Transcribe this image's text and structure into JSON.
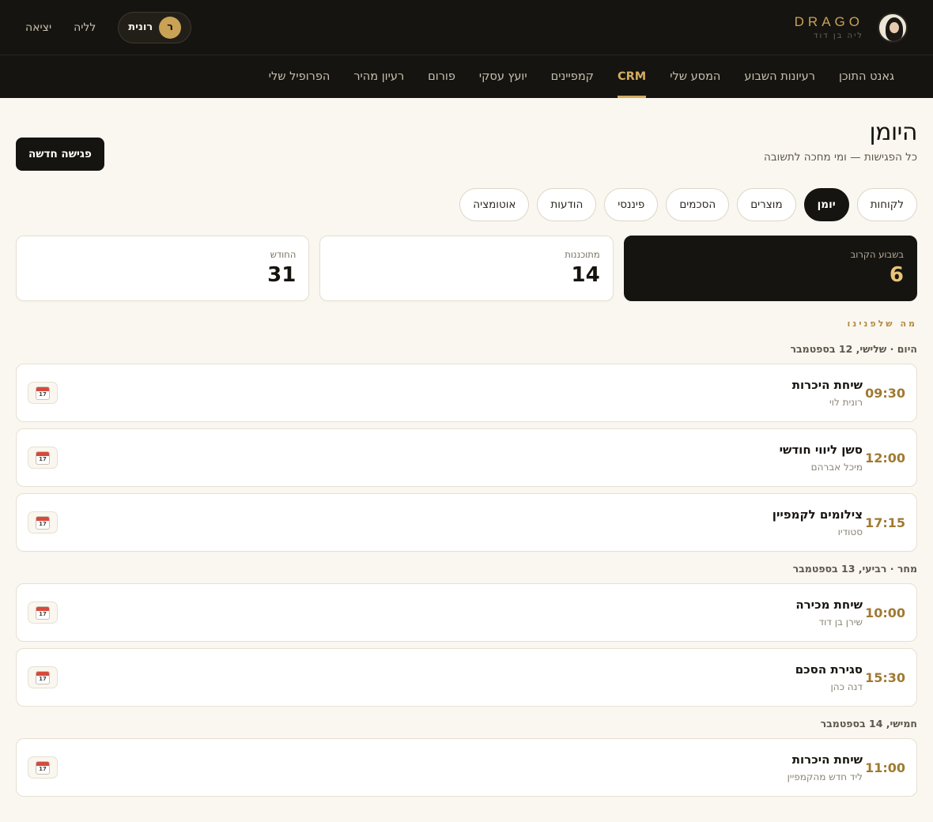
{
  "header": {
    "brand_name": "DRAGO",
    "brand_sub": "ליה בן דוד",
    "user_initial": "ר",
    "user_name": "רונית",
    "night_label": "לליה",
    "logout_label": "יציאה"
  },
  "nav": [
    {
      "label": "גאנט התוכן",
      "active": false
    },
    {
      "label": "רעיונות השבוע",
      "active": false
    },
    {
      "label": "המסע שלי",
      "active": false
    },
    {
      "label": "CRM",
      "active": true
    },
    {
      "label": "קמפיינים",
      "active": false
    },
    {
      "label": "יועץ עסקי",
      "active": false
    },
    {
      "label": "פורום",
      "active": false
    },
    {
      "label": "רעיון מהיר",
      "active": false
    },
    {
      "label": "הפרופיל שלי",
      "active": false
    }
  ],
  "page": {
    "title": "היומן",
    "subtitle": "כל הפגישות — ומי מחכה לתשובה",
    "new_meeting_label": "פגישה חדשה"
  },
  "tabs": [
    {
      "label": "לקוחות",
      "active": false
    },
    {
      "label": "יומן",
      "active": true
    },
    {
      "label": "מוצרים",
      "active": false
    },
    {
      "label": "הסכמים",
      "active": false
    },
    {
      "label": "פיננסי",
      "active": false
    },
    {
      "label": "הודעות",
      "active": false
    },
    {
      "label": "אוטומציה",
      "active": false
    }
  ],
  "stats": [
    {
      "label": "בשבוע הקרוב",
      "value": "6",
      "dark": true
    },
    {
      "label": "מתוכננות",
      "value": "14",
      "dark": false
    },
    {
      "label": "החודש",
      "value": "31",
      "dark": false
    }
  ],
  "agenda": {
    "kicker": "מה שלפנינו",
    "calendar_icon_day": "17",
    "days": [
      {
        "label": "היום · שלישי, 12 בספטמבר",
        "events": [
          {
            "time": "09:30",
            "title": "שיחת היכרות",
            "who": "רונית לוי"
          },
          {
            "time": "12:00",
            "title": "סשן ליווי חודשי",
            "who": "מיכל אברהם"
          },
          {
            "time": "17:15",
            "title": "צילומים לקמפיין",
            "who": "סטודיו"
          }
        ]
      },
      {
        "label": "מחר · רביעי, 13 בספטמבר",
        "events": [
          {
            "time": "10:00",
            "title": "שיחת מכירה",
            "who": "שירן בן דוד"
          },
          {
            "time": "15:30",
            "title": "סגירת הסכם",
            "who": "דנה כהן"
          }
        ]
      },
      {
        "label": "חמישי, 14 בספטמבר",
        "events": [
          {
            "time": "11:00",
            "title": "שיחת היכרות",
            "who": "ליד חדש מהקמפיין"
          }
        ]
      }
    ]
  }
}
